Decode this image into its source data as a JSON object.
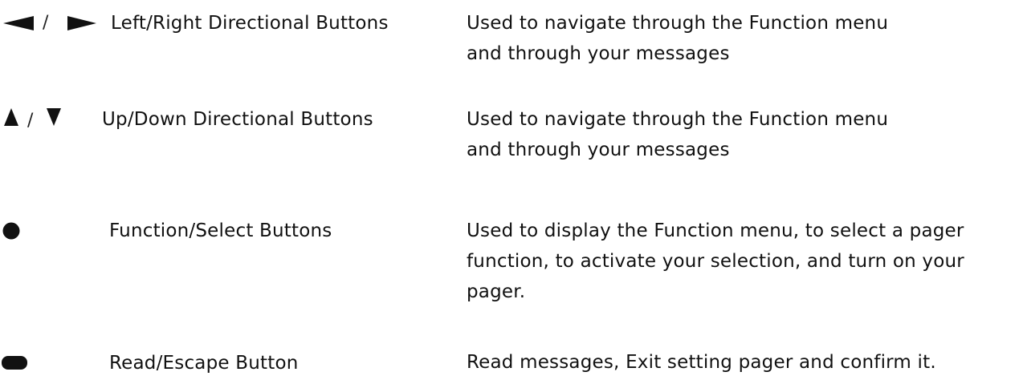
{
  "buttons": [
    {
      "icons": [
        "triangle-left-icon",
        "triangle-right-icon"
      ],
      "separator": "/",
      "name": "Left/Right Directional Buttons",
      "description": [
        "Used to navigate through the Function menu",
        "and through your messages"
      ]
    },
    {
      "icons": [
        "triangle-up-icon",
        "triangle-down-icon"
      ],
      "separator": "/",
      "name": "Up/Down Directional Buttons",
      "description": [
        "Used to navigate through the Function menu",
        "and through your messages"
      ]
    },
    {
      "icons": [
        "filled-circle-icon"
      ],
      "name": "Function/Select Buttons",
      "description": [
        "Used to display the Function menu, to select a pager",
        "function, to activate your selection, and turn on your",
        "pager."
      ]
    },
    {
      "icons": [
        "rounded-bar-icon"
      ],
      "name": "Read/Escape Button",
      "description": [
        "Read messages, Exit setting pager and confirm it."
      ]
    }
  ],
  "colors": {
    "text": "#111111",
    "icon": "#111111"
  }
}
